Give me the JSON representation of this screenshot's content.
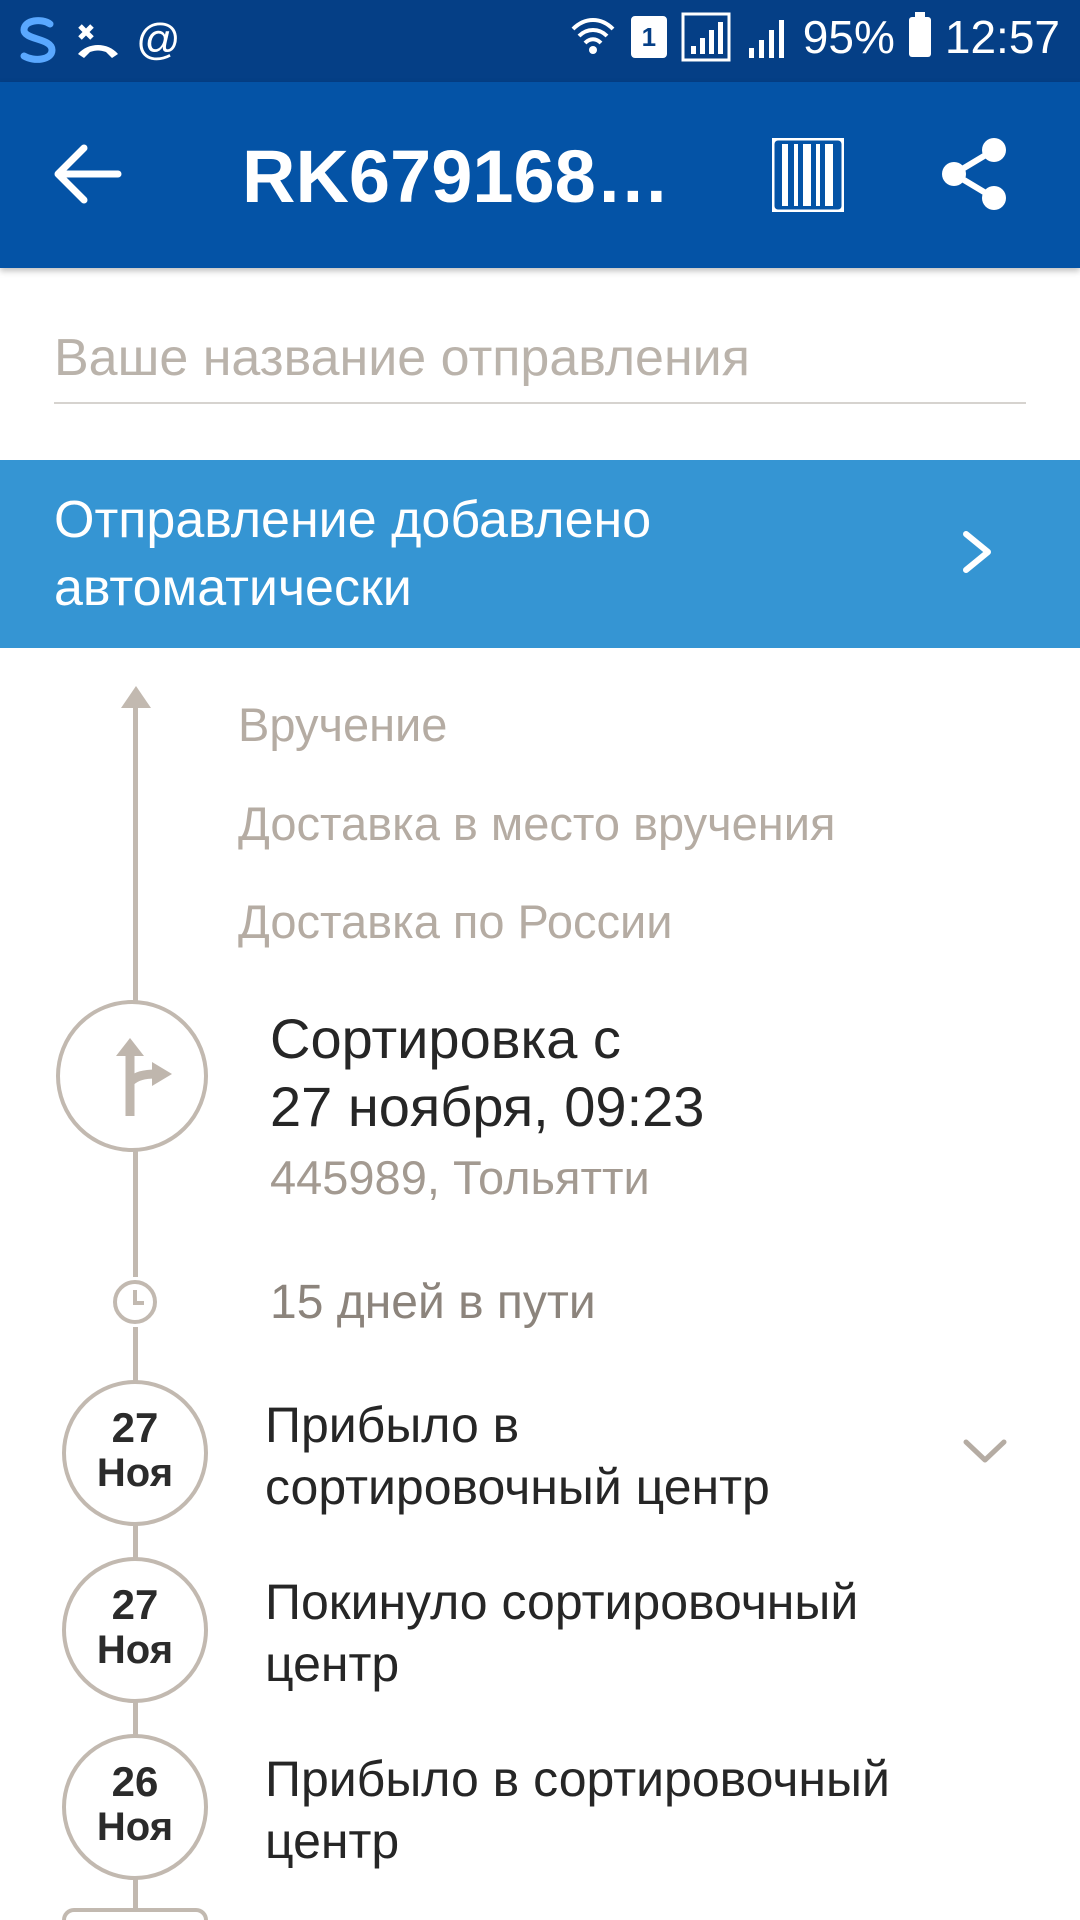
{
  "status_bar": {
    "battery": "95%",
    "time": "12:57",
    "sim_slot": "1"
  },
  "app_bar": {
    "title": "RK6791688..."
  },
  "name_field": {
    "placeholder": "Ваше название отправления"
  },
  "banner": {
    "text": "Отправление добавлено автоматически"
  },
  "timeline": {
    "future_steps": [
      "Вручение",
      "Доставка в место вручения",
      "Доставка по России"
    ],
    "current": {
      "title_line1": "Сортировка с",
      "title_line2": "27 ноября, 09:23",
      "address": "445989, Тольятти"
    },
    "transit": "15 дней в пути",
    "events": [
      {
        "day": "27",
        "month": "Ноя",
        "line1": "Прибыло в",
        "line2": "сортировочный центр"
      },
      {
        "day": "27",
        "month": "Ноя",
        "line1": "Покинуло сортировочный",
        "line2": "центр"
      },
      {
        "day": "26",
        "month": "Ноя",
        "line1": "Прибыло в сортировочный",
        "line2": "центр"
      }
    ]
  },
  "colors": {
    "status_bar": "#053f86",
    "app_bar": "#0453a6",
    "banner": "#3595d3",
    "timeline_line": "#c2b9b0"
  }
}
